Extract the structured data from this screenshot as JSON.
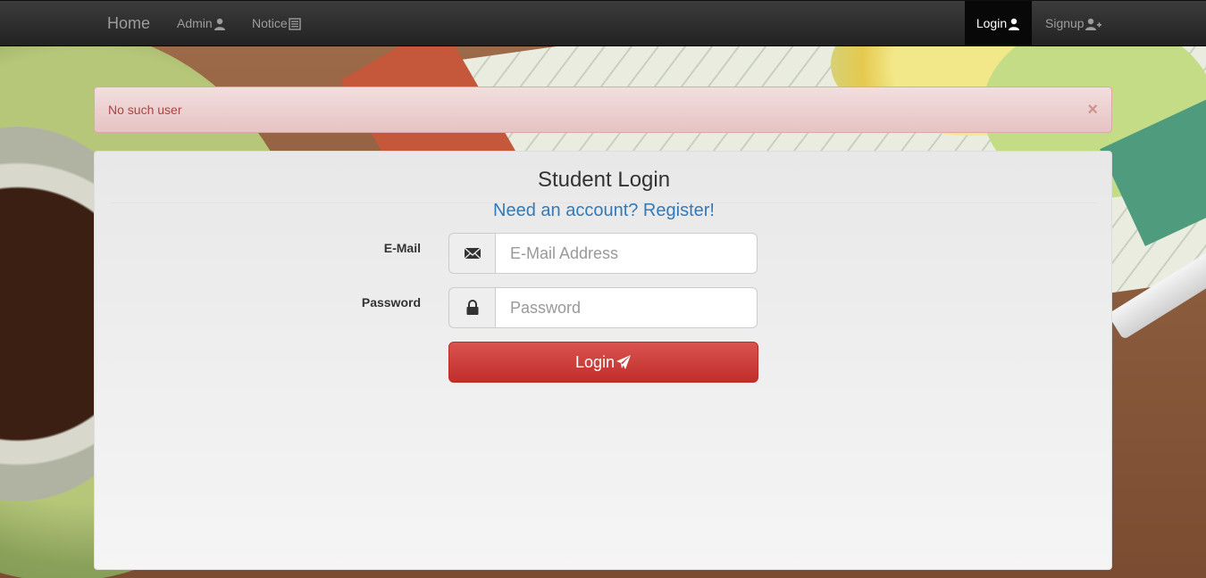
{
  "navbar": {
    "brand": "Home",
    "items": [
      {
        "label": "Admin",
        "icon": "user-icon"
      },
      {
        "label": "Notice",
        "icon": "list-alt-icon"
      }
    ],
    "right_items": [
      {
        "label": "Login",
        "icon": "user-icon",
        "active": true
      },
      {
        "label": "Signup",
        "icon": "add-user-icon",
        "active": false
      }
    ]
  },
  "alert": {
    "message": "No such user",
    "close_symbol": "×"
  },
  "panel": {
    "title": "Student Login",
    "register_link": "Need an account? Register!"
  },
  "form": {
    "email_label": "E-Mail",
    "email_placeholder": "E-Mail Address",
    "email_icon": "envelope-icon",
    "password_label": "Password",
    "password_placeholder": "Password",
    "password_icon": "lock-icon",
    "submit_label": "Login",
    "submit_icon": "paper-plane-icon"
  },
  "colors": {
    "navbar": "#222222",
    "alert_bg": "#f2dede",
    "alert_text": "#a94442",
    "link": "#337ab7",
    "button": "#d9534f"
  }
}
